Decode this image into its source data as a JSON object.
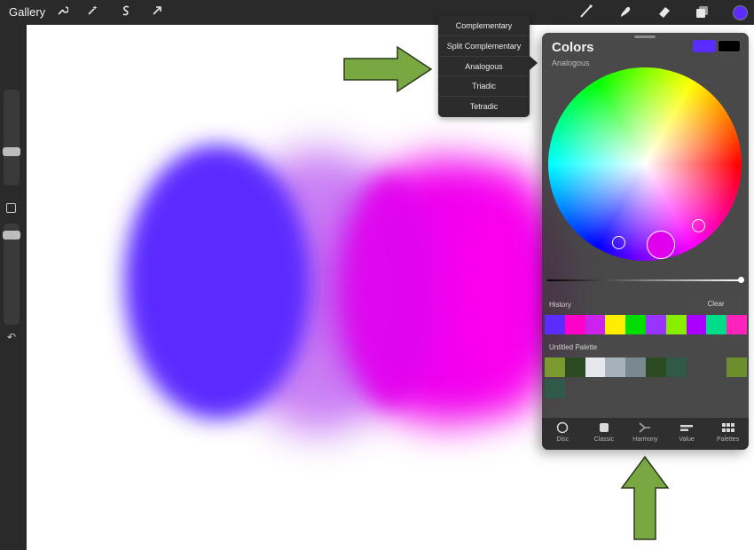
{
  "toolbar": {
    "gallery_label": "Gallery",
    "left_icons": [
      "wrench-icon",
      "magic-wand-icon",
      "selection-s-icon",
      "transform-arrow-icon"
    ],
    "right_icons": [
      "brush-icon",
      "smudge-icon",
      "eraser-icon",
      "layers-icon"
    ],
    "active_color": "#5b2cff"
  },
  "harmony_menu": {
    "items": [
      "Complementary",
      "Split Complementary",
      "Analogous",
      "Triadic",
      "Tetradic"
    ],
    "selected": "Analogous"
  },
  "colors_panel": {
    "title": "Colors",
    "mode": "Analogous",
    "primary_color": "#5b2cff",
    "secondary_color": "#000000",
    "history_label": "History",
    "clear_label": "Clear",
    "history": [
      "#5b2cff",
      "#ff00c8",
      "#cc22ee",
      "#ffee00",
      "#00dd00",
      "#9933ff",
      "#88ee00",
      "#aa00ff",
      "#00dd88",
      "#ff22bb"
    ],
    "palette_label": "Untitled Palette",
    "palette": [
      "#7a9a30",
      "#2b4a22",
      "#e4e8ea",
      "#a5b2ba",
      "#7a8890",
      "#2b4a22",
      "#2f5a48",
      "#6d8e2c",
      "#2f5a48"
    ],
    "tabs": [
      {
        "label": "Disc",
        "icon": "disc-icon"
      },
      {
        "label": "Classic",
        "icon": "classic-square-icon"
      },
      {
        "label": "Harmony",
        "icon": "harmony-icon"
      },
      {
        "label": "Value",
        "icon": "value-sliders-icon"
      },
      {
        "label": "Palettes",
        "icon": "palettes-grid-icon"
      }
    ]
  },
  "annotations": {
    "arrow_color": "#79a843"
  }
}
